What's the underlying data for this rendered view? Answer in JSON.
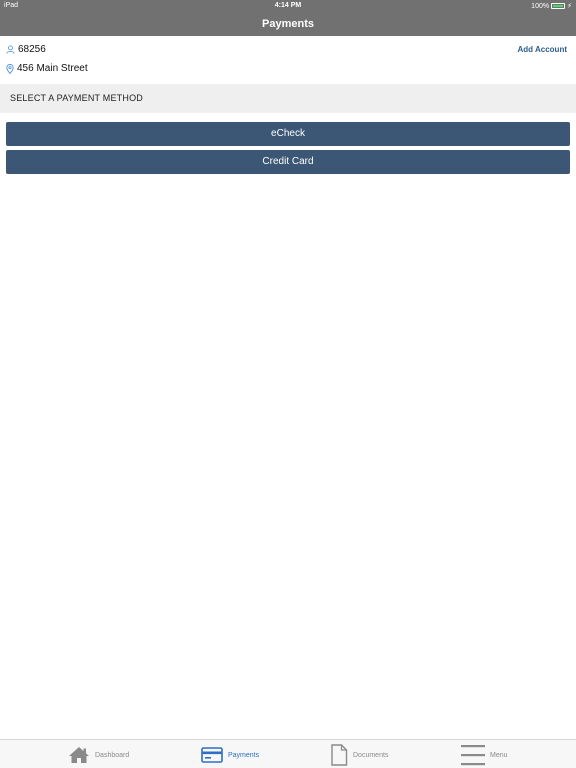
{
  "status_bar": {
    "device": "iPad",
    "time": "4:14 PM",
    "battery": "100%"
  },
  "nav": {
    "title": "Payments"
  },
  "account": {
    "number": "68256",
    "address": "456 Main Street",
    "add_account_label": "Add Account"
  },
  "section": {
    "title": "SELECT A PAYMENT METHOD"
  },
  "payment_methods": [
    {
      "label": "eCheck"
    },
    {
      "label": "Credit Card"
    }
  ],
  "tabs": [
    {
      "label": "Dashboard",
      "icon": "house-icon"
    },
    {
      "label": "Payments",
      "icon": "credit-card-icon",
      "active": true
    },
    {
      "label": "Documents",
      "icon": "document-icon"
    },
    {
      "label": "Menu",
      "icon": "hamburger-icon"
    }
  ],
  "colors": {
    "nav_bg": "#717171",
    "button_bg": "#3b5775",
    "link": "#2b5f8c",
    "active_tab": "#2d6ec7",
    "inactive_tab": "#8a8a8a",
    "section_bg": "#efefef"
  }
}
